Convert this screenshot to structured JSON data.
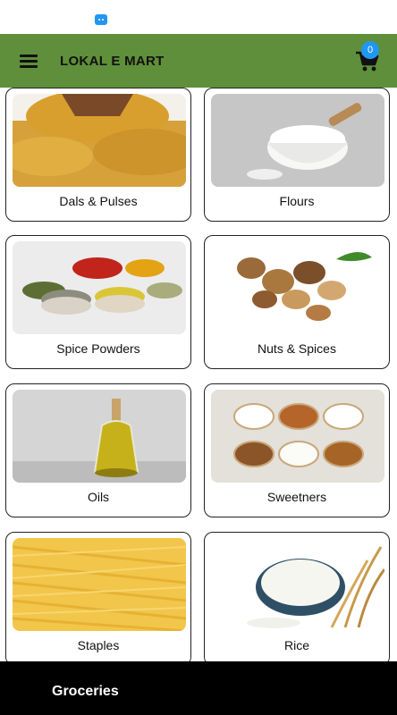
{
  "app_bar": {
    "title": "LOKAL E MART",
    "cart_count": "0"
  },
  "categories": [
    {
      "label": "Dals & Pulses"
    },
    {
      "label": "Flours"
    },
    {
      "label": "Spice Powders"
    },
    {
      "label": "Nuts & Spices"
    },
    {
      "label": "Oils"
    },
    {
      "label": "Sweetners"
    },
    {
      "label": "Staples"
    },
    {
      "label": "Rice"
    }
  ],
  "bottom_bar": {
    "title": "Groceries"
  },
  "colors": {
    "app_bar": "#5f8f3a",
    "badge": "#2196f3",
    "bottom_bar": "#000000"
  }
}
